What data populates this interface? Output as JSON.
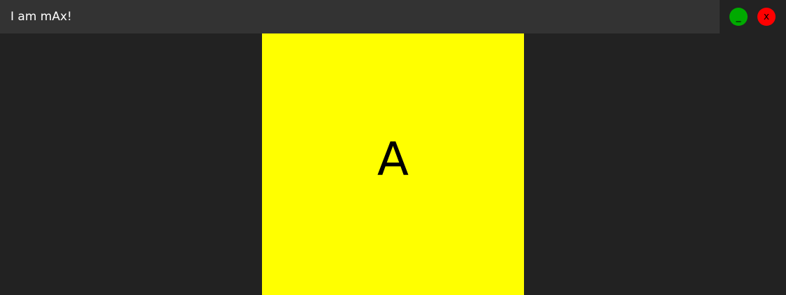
{
  "window": {
    "title": "I am mAx!"
  },
  "controls": {
    "minimize_label": "_",
    "minimize_color": "#00aa00",
    "close_label": "x",
    "close_color": "#ff0000"
  },
  "content": {
    "panel_letter": "A",
    "panel_color": "#ffff00"
  }
}
